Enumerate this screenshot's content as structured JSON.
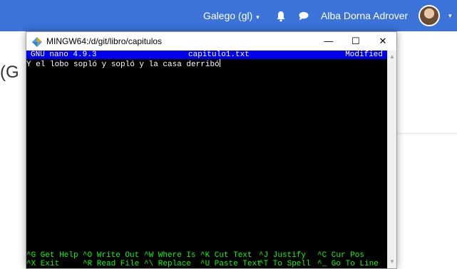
{
  "topbar": {
    "language": "Galego (gl)",
    "user_name": "Alba Dorna Adrover",
    "caret": "▾",
    "bell_icon": "bell-icon",
    "chat_icon": "chat-bubble-icon"
  },
  "background": {
    "heading_fragment": "(G"
  },
  "window": {
    "title": "MINGW64:/d/git/libro/capitulos",
    "minimize": "—",
    "maximize": "☐",
    "close": "✕"
  },
  "nano": {
    "version": "GNU nano 4.9.3",
    "filename": "capitulo1.txt",
    "status": "Modified",
    "buffer_text": "Y el lobo sopló y sopló y la casa derribó",
    "shortcuts": [
      {
        "text": "^G Get Help"
      },
      {
        "text": "^O Write Out"
      },
      {
        "text": "^W Where Is"
      },
      {
        "text": "^K Cut Text"
      },
      {
        "text": "^J Justify"
      },
      {
        "text": "^C Cur Pos"
      },
      {
        "text": "^X Exit"
      },
      {
        "text": "^R Read File"
      },
      {
        "text": "^\\ Replace"
      },
      {
        "text": "^U Paste Text"
      },
      {
        "text": "^T To Spell"
      },
      {
        "text": "^_ Go To Line"
      }
    ]
  },
  "scrollbar": {
    "up_arrow": "▲",
    "down_arrow": "▼"
  },
  "colors": {
    "topbar": "#3b73d9",
    "nano_header_bg": "#0000ee",
    "shortcut_text": "#00ff00",
    "terminal_bg": "#000000"
  }
}
